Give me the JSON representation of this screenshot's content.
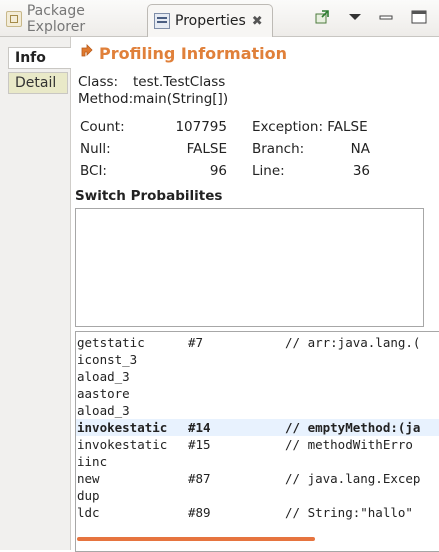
{
  "tabs": {
    "package_explorer": "Package Explorer",
    "properties": "Properties"
  },
  "side_tabs": {
    "info": "Info",
    "detail": "Detail"
  },
  "title": "Profiling Information",
  "class": {
    "label": "Class:",
    "value": "test.TestClass"
  },
  "method": {
    "label": "Method:",
    "value": "main(String[])"
  },
  "stats": {
    "count_label": "Count:",
    "count_value": "107795",
    "exception_label": "Exception: FALSE",
    "null_label": "Null:",
    "null_value": "FALSE",
    "branch_label": "Branch:",
    "branch_value": "NA",
    "bci_label": "BCI:",
    "bci_value": "96",
    "line_label": "Line:",
    "line_value": "36"
  },
  "switch_title": "Switch Probabilites",
  "code": [
    {
      "op": "getstatic",
      "arg": "#7",
      "comment": "// arr:java.lang.("
    },
    {
      "op": "iconst_3",
      "arg": "",
      "comment": ""
    },
    {
      "op": "aload_3",
      "arg": "",
      "comment": ""
    },
    {
      "op": "aastore",
      "arg": "",
      "comment": ""
    },
    {
      "op": "aload_3",
      "arg": "",
      "comment": ""
    },
    {
      "op": "invokestatic",
      "arg": "#14",
      "comment": "// emptyMethod:(ja"
    },
    {
      "op": "invokestatic",
      "arg": "#15",
      "comment": "// methodWithErro"
    },
    {
      "op": "iinc",
      "arg": "",
      "comment": ""
    },
    {
      "op": "new",
      "arg": "#87",
      "comment": "// java.lang.Excep"
    },
    {
      "op": "dup",
      "arg": "",
      "comment": ""
    },
    {
      "op": "ldc",
      "arg": "#89",
      "comment": "// String:\"hallo\""
    }
  ],
  "selected_row": 5,
  "colors": {
    "accent": "#e0803a",
    "selection": "#e8f2fe",
    "scroll_thumb": "#e6743f"
  },
  "icons": [
    "package-explorer-icon",
    "properties-icon",
    "close-icon",
    "pin-icon",
    "view-menu-icon",
    "profiling-icon"
  ]
}
